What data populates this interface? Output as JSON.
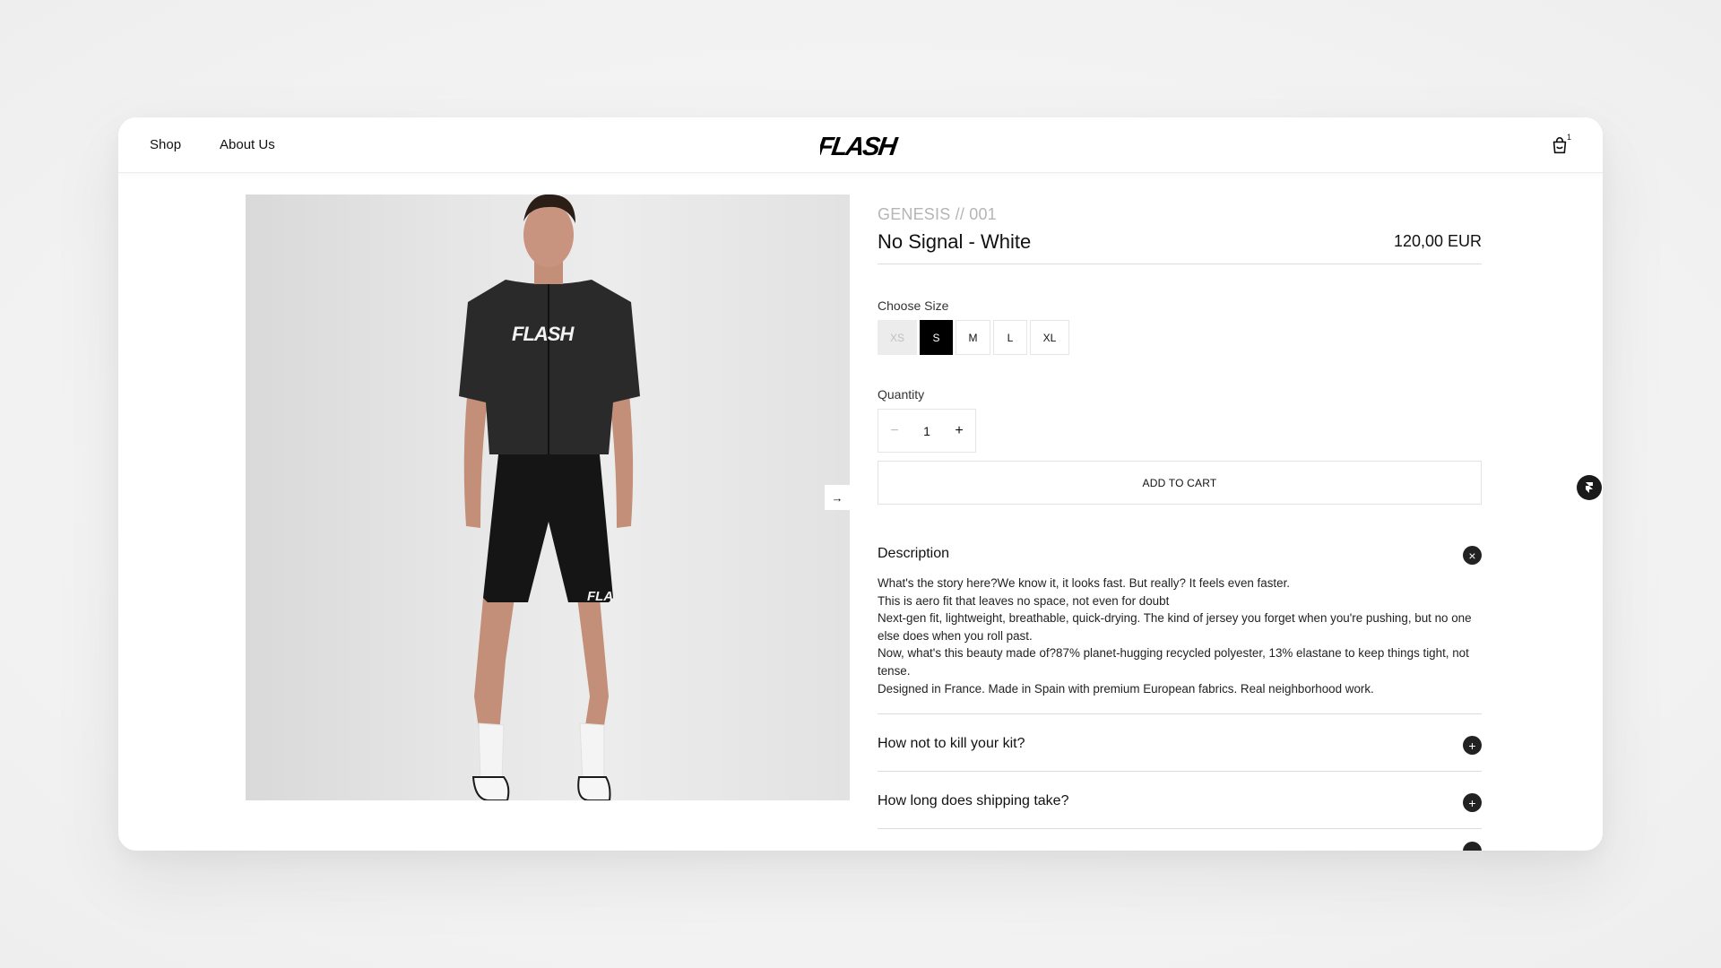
{
  "nav": {
    "shop": "Shop",
    "about": "About Us"
  },
  "brand": {
    "logo_text": "FLASH"
  },
  "cart": {
    "count": "1",
    "icon": "shopping-bag-icon"
  },
  "product": {
    "collection": "GENESIS // 001",
    "title": "No Signal - White",
    "price": "120,00 EUR",
    "image_alt": "Model wearing black FLASH cycling jersey and bib shorts",
    "jersey_print": "FLASH",
    "shorts_print": "FLA"
  },
  "size": {
    "label": "Choose Size",
    "options": [
      "XS",
      "S",
      "M",
      "L",
      "XL"
    ],
    "selected": "S",
    "unavailable": [
      "XS"
    ]
  },
  "quantity": {
    "label": "Quantity",
    "value": "1",
    "minus": "−",
    "plus": "+"
  },
  "add_to_cart": "ADD TO CART",
  "accordion": {
    "description": {
      "title": "Description",
      "icon": "close-icon",
      "lines": [
        "What's the story here?We know it, it looks fast. But really? It feels even faster.",
        "This is aero fit that leaves no space, not even for doubt",
        "Next-gen fit, lightweight, breathable, quick-drying. The kind of jersey you forget when you're pushing, but no one else does when you roll past.",
        "Now, what's this beauty made of?87% planet-hugging recycled polyester, 13% elastane to keep things tight, not tense.",
        "Designed in France. Made in Spain with premium European fabrics. Real neighborhood work."
      ]
    },
    "care": {
      "title": "How not to kill your kit?",
      "icon": "plus-icon"
    },
    "shipping": {
      "title": "How long does shipping take?",
      "icon": "plus-icon"
    }
  },
  "colors": {
    "accent": "#000000",
    "muted_text": "#b5b5b5",
    "page_bg": "#f3f3f3",
    "image_bg": "#e4e4e4"
  }
}
